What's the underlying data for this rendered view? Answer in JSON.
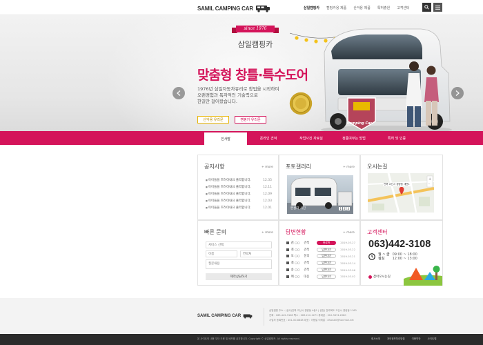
{
  "header": {
    "logo_text": "SAMIL CAMPING CAR",
    "nav": [
      "삼일캠핑카",
      "캠핑카용 제품",
      "산악용 제품",
      "특허출원",
      "고객센터"
    ],
    "active_nav_index": 0
  },
  "hero": {
    "badge": "since 1976",
    "company": "삼일캠핑카",
    "title": "맞춤형 창틀·특수도어",
    "desc_lines": [
      "1976년 삼일자동차유리로 창업을 시작하여",
      "오랜경험과 독자적인 기술력으로",
      "한길만 걸어왔습니다."
    ],
    "btn1": "산악용 유리문",
    "btn2": "캠핑카 유리문",
    "logo_badge": "Camping Car",
    "slide_count": 5,
    "active_slide": 0
  },
  "tabs": [
    "인사말",
    "온라인 견적",
    "작업사진 자료실",
    "정품여부는 방법",
    "특허 및 인증"
  ],
  "active_tab": 0,
  "notice": {
    "title": "공지사항",
    "more": "+ more",
    "items": [
      {
        "text": "이이들을 즈려이내요 출력합니다.",
        "date": "12.35"
      },
      {
        "text": "이이들을 즈려이내요 출력합니다.",
        "date": "12.11"
      },
      {
        "text": "이이들을 즈려이내요 출력합니다.",
        "date": "12.09"
      },
      {
        "text": "이이들을 즈려이내요 출력합니다.",
        "date": "12.03"
      },
      {
        "text": "이이들을 즈려이내요 출력합니다.",
        "date": "12.01"
      }
    ]
  },
  "gallery": {
    "title": "포토갤러리",
    "more": "+ more",
    "caption": "완성차 사진",
    "nav": [
      "1",
      "2",
      "3"
    ]
  },
  "map": {
    "title": "오시는길",
    "label": "전북 고산시 경량동 새만1"
  },
  "quick": {
    "title": "빠른 문의",
    "more": "+ more",
    "select": "서비스 선택",
    "name": "이름",
    "phone": "연락처",
    "content": "질문내용",
    "submit": "제작상담하기"
  },
  "answers": {
    "title": "답변현황",
    "more": "+ more",
    "rows": [
      {
        "name": "김 ○○",
        "item": "견적",
        "status": "완료된",
        "done": true,
        "date": "2019.03.27"
      },
      {
        "name": "최 ○○",
        "item": "견적",
        "status": "답변대기",
        "done": false,
        "date": "2019.03.22"
      },
      {
        "name": "오 ○○",
        "item": "문의",
        "status": "답변대기",
        "done": false,
        "date": "2019.03.21"
      },
      {
        "name": "최 ○○",
        "item": "견적",
        "status": "답변대기",
        "done": false,
        "date": "2019.03.14"
      },
      {
        "name": "송 ○○",
        "item": "견적",
        "status": "답변대기",
        "done": false,
        "date": "2019.03.06"
      },
      {
        "name": "에 ○○",
        "item": "대응",
        "status": "답변대기",
        "done": false,
        "date": "2019.03.02"
      }
    ]
  },
  "customer": {
    "title": "고객센터",
    "phone": "063)442-3108",
    "days": "월 ~ 금",
    "lunch": "점심",
    "hours": "09:00 ~ 18:00",
    "lunch_hours": "12:00 ~ 13:00",
    "directions": "찾아오시는길"
  },
  "footer": {
    "logo_text": "SAMIL CAMPING CAR",
    "info": [
      "삼일캠핑 주소 : (공사)전북 고산시 경량동 A동1 | 공장) 전라북도 고산시 경량동 1160",
      "전화 : 063-442-3108 팩스 : 063-212-1271 휴대폰 : 010-3674-2080",
      "사업자 등록번호 : 401-00-8848 대표 : 이형일 이메일 : dhanaili@hanmail.net"
    ],
    "copyright": "본 사이트의 내용 무단 도용 및 배포를 금지합니다. Copyright © 삼일캠핑카. All rights reserved.",
    "links": [
      "회사소개",
      "개인정보처리방침",
      "이용약관",
      "사이트맵"
    ]
  },
  "colors": {
    "accent": "#d4145a",
    "dark": "#2b2b2b"
  }
}
